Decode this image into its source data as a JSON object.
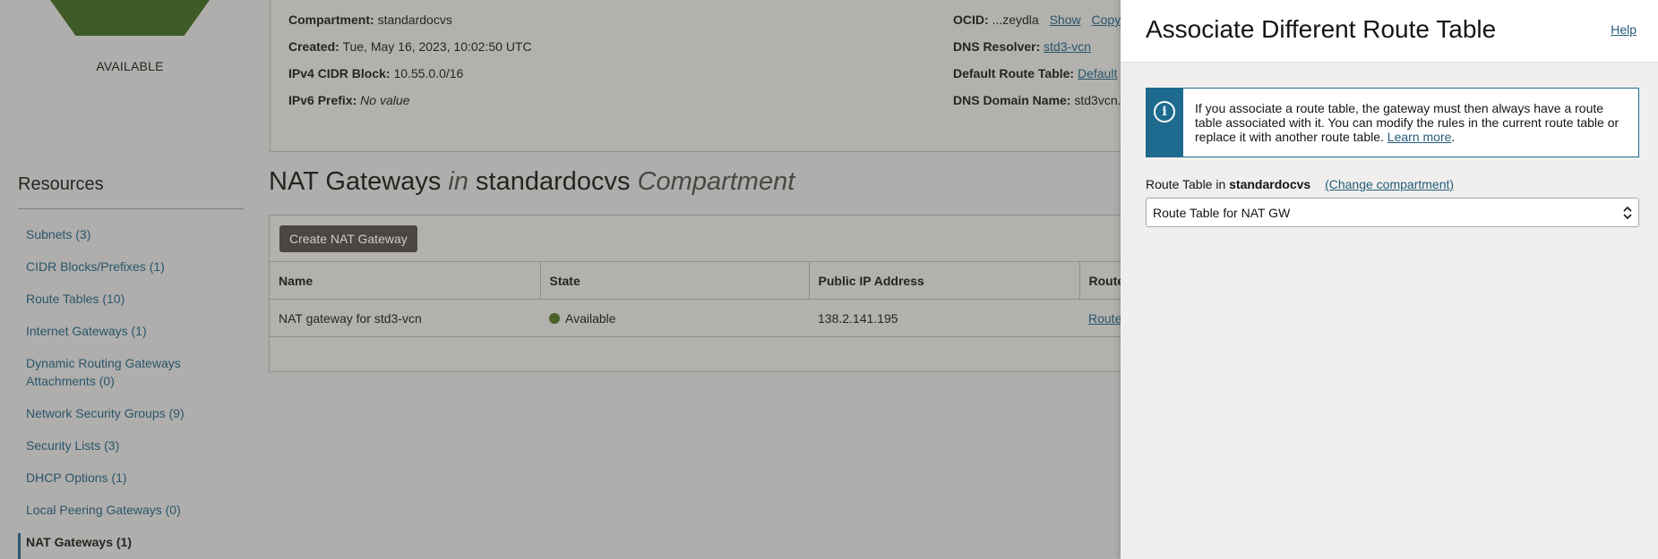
{
  "vcn": {
    "status": "AVAILABLE"
  },
  "details": {
    "compartment_label": "Compartment:",
    "compartment_value": "standardocvs",
    "created_label": "Created:",
    "created_value": "Tue, May 16, 2023, 10:02:50 UTC",
    "ipv4_label": "IPv4 CIDR Block:",
    "ipv4_value": "10.55.0.0/16",
    "ipv6_label": "IPv6 Prefix:",
    "ipv6_value": "No value",
    "ocid_label": "OCID:",
    "ocid_value": "...zeydla",
    "ocid_show": "Show",
    "ocid_copy": "Copy",
    "dns_resolver_label": "DNS Resolver:",
    "dns_resolver_value": "std3-vcn",
    "default_rt_label": "Default Route Table:",
    "default_rt_value": "Default",
    "dns_domain_label": "DNS Domain Name:",
    "dns_domain_value": "std3vcn."
  },
  "resources": {
    "title": "Resources",
    "items": [
      {
        "label": "Subnets (3)"
      },
      {
        "label": "CIDR Blocks/Prefixes (1)"
      },
      {
        "label": "Route Tables (10)"
      },
      {
        "label": "Internet Gateways (1)"
      },
      {
        "label": "Dynamic Routing Gateways Attachments (0)"
      },
      {
        "label": "Network Security Groups (9)"
      },
      {
        "label": "Security Lists (3)"
      },
      {
        "label": "DHCP Options (1)"
      },
      {
        "label": "Local Peering Gateways (0)"
      },
      {
        "label": "NAT Gateways (1)"
      }
    ]
  },
  "section": {
    "title_part1": "NAT Gateways",
    "title_in": "in",
    "title_compartment": "standardocvs",
    "title_part2": "Compartment"
  },
  "table": {
    "create_button": "Create NAT Gateway",
    "columns": [
      "Name",
      "State",
      "Public IP Address",
      "Route"
    ],
    "rows": [
      {
        "name": "NAT gateway for std3-vcn",
        "state": "Available",
        "public_ip": "138.2.141.195",
        "route": "Route"
      }
    ]
  },
  "drawer": {
    "title": "Associate Different Route Table",
    "help": "Help",
    "info_text": "If you associate a route table, the gateway must then always have a route table associated with it. You can modify the rules in the current route table or replace it with another route table.",
    "info_link": "Learn more",
    "info_tail": ".",
    "rt_label_prefix": "Route Table in",
    "rt_label_compartment": "standardocvs",
    "change_compartment": "(Change compartment)",
    "rt_selected": "Route Table for NAT GW"
  },
  "colors": {
    "accent": "#245d7a",
    "info_strip": "#1e6b8f",
    "status_green": "#4c6d2a",
    "vcn_green": "#3f6520"
  }
}
